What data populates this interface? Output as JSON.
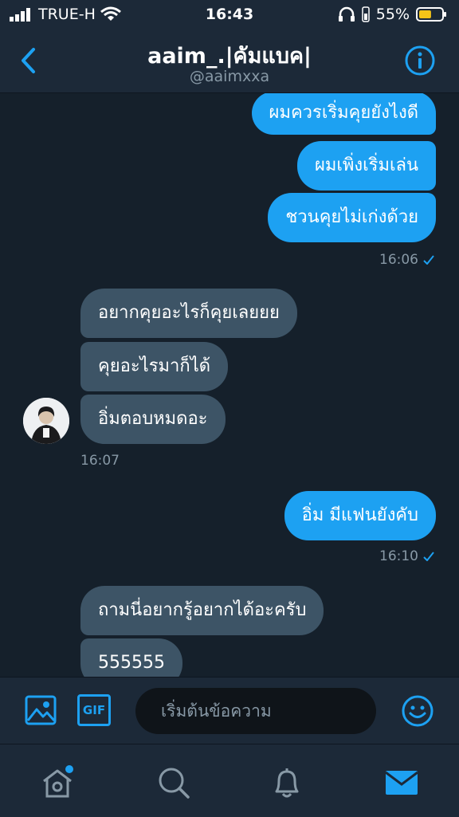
{
  "status_bar": {
    "carrier": "TRUE-H",
    "time": "16:43",
    "battery": "55%",
    "battery_level": 0.55
  },
  "header": {
    "title": "aaim_.|คัมแบค|",
    "handle": "@aaimxxa",
    "back_icon": "chevron-left-icon",
    "info_icon": "info-icon"
  },
  "messages": [
    {
      "direction": "out",
      "text": "ผมควรเริ่มคุยยังไงดี"
    },
    {
      "direction": "out",
      "text": "ผมเพิ่งเริ่มเล่น"
    },
    {
      "direction": "out",
      "text": "ชวนคุยไม่เก่งด้วย"
    },
    {
      "direction": "out_time",
      "text": "16:06"
    },
    {
      "direction": "in",
      "text": "อยากคุยอะไรก็คุยเลยยย"
    },
    {
      "direction": "in",
      "text": "คุยอะไรมาก็ได้"
    },
    {
      "direction": "in",
      "text": "อิ่มตอบหมดอะ"
    },
    {
      "direction": "in_time",
      "text": "16:07"
    },
    {
      "direction": "out",
      "text": "อิ่ม มีแฟนยังคับ"
    },
    {
      "direction": "out_time",
      "text": "16:10"
    },
    {
      "direction": "in",
      "text": "ถามนี่อยากรู้อยากได้อะครับ"
    },
    {
      "direction": "in",
      "text": "555555"
    }
  ],
  "composer": {
    "placeholder": "เริ่มต้นข้อความ",
    "gif_label": "GIF",
    "image_icon": "image-icon",
    "emoji_icon": "emoji-icon"
  },
  "tabs": [
    {
      "name": "home-icon",
      "has_badge": true
    },
    {
      "name": "search-icon"
    },
    {
      "name": "bell-icon"
    },
    {
      "name": "mail-icon",
      "active": true
    }
  ],
  "colors": {
    "background": "#15202b",
    "bar": "#1c2938",
    "accent": "#1da1f2",
    "incoming_bubble": "#3d5466",
    "muted_text": "#8899a6",
    "battery": "#f5c518"
  }
}
